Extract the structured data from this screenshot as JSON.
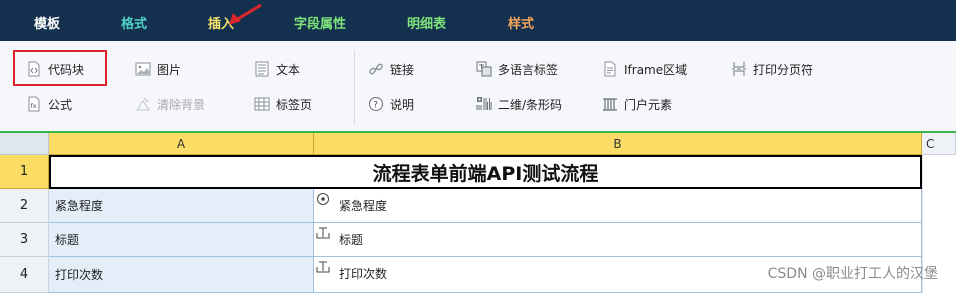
{
  "menu": {
    "tabs": [
      {
        "label": "模板",
        "color": "#ffffff"
      },
      {
        "label": "格式",
        "color": "#4fd0c8"
      },
      {
        "label": "插入",
        "color": "#f5e36b"
      },
      {
        "label": "字段属性",
        "color": "#7ee37a"
      },
      {
        "label": "明细表",
        "color": "#7ee37a"
      },
      {
        "label": "样式",
        "color": "#f2a65a"
      }
    ]
  },
  "ribbon": {
    "items": [
      {
        "label": "代码块",
        "icon": "code-icon",
        "disabled": false
      },
      {
        "label": "公式",
        "icon": "formula-icon",
        "disabled": false
      },
      {
        "label": "图片",
        "icon": "image-icon",
        "disabled": false
      },
      {
        "label": "清除背景",
        "icon": "clear-background-icon",
        "disabled": true
      },
      {
        "label": "文本",
        "icon": "text-icon",
        "disabled": false
      },
      {
        "label": "标签页",
        "icon": "tab-page-icon",
        "disabled": false
      },
      {
        "label": "链接",
        "icon": "link-icon",
        "disabled": false
      },
      {
        "label": "说明",
        "icon": "help-icon",
        "disabled": false
      },
      {
        "label": "多语言标签",
        "icon": "multilanguage-icon",
        "disabled": false
      },
      {
        "label": "二维/条形码",
        "icon": "qrcode-icon",
        "disabled": false
      },
      {
        "label": "Iframe区域",
        "icon": "iframe-icon",
        "disabled": false
      },
      {
        "label": "门户元素",
        "icon": "portal-icon",
        "disabled": false
      },
      {
        "label": "打印分页符",
        "icon": "page-break-icon",
        "disabled": false
      }
    ]
  },
  "grid": {
    "columns": [
      "A",
      "B",
      "C"
    ],
    "rows": [
      "1",
      "2",
      "3",
      "4"
    ],
    "title": "流程表单前端API测试流程",
    "fields": [
      {
        "label": "紧急程度",
        "value": "紧急程度",
        "icon": "radio-field-icon"
      },
      {
        "label": "标题",
        "value": "标题",
        "icon": "text-field-icon"
      },
      {
        "label": "打印次数",
        "value": "打印次数",
        "icon": "text-field-icon"
      }
    ]
  },
  "watermark": "CSDN @职业打工人的汉堡",
  "colors": {
    "menubar_bg": "#14304f",
    "ribbon_bg": "#f5f7fa",
    "header_yellow": "#fbdc65",
    "label_cell_bg": "#e3eef9",
    "highlight_red": "#e0262d",
    "accent_green": "#39b54a"
  }
}
